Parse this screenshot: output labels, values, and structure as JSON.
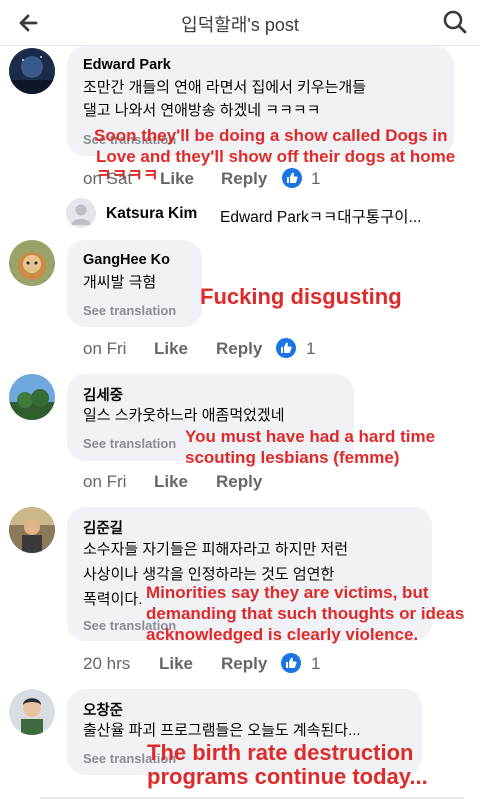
{
  "header": {
    "title": "입덕할래's post"
  },
  "comments": [
    {
      "name": "Edward Park",
      "lines": [
        "조만간 개들의 연애 라면서 집에서 키우는개들",
        "댈고 나와서 연애방송 하겠네 ㅋㅋㅋㅋ"
      ],
      "see_translation": "See translation",
      "time": "on Sat",
      "like": "Like",
      "reply": "Reply",
      "likes": "1",
      "overlay": [
        "Soon they'll be doing a show called Dogs in",
        "Love and they'll show off their dogs at home",
        "ㅋㅋㅋㅋ"
      ]
    },
    {
      "name": "GangHee Ko",
      "lines": [
        "개씨발 극혐"
      ],
      "see_translation": "See translation",
      "time": "on Fri",
      "like": "Like",
      "reply": "Reply",
      "likes": "1",
      "overlay": [
        "Fucking disgusting"
      ]
    },
    {
      "name": "김세중",
      "lines": [
        "일스 스카웃하느라 애좀먹었겠네"
      ],
      "see_translation": "See translation",
      "time": "on Fri",
      "like": "Like",
      "reply": "Reply",
      "overlay": [
        "You must have had a hard time",
        "scouting lesbians (femme)"
      ]
    },
    {
      "name": "김준길",
      "lines": [
        "소수자들 자기들은 피해자라고 하지만 저런",
        "사상이나 생각을 인정하라는 것도 엄연한",
        "폭력이다."
      ],
      "see_translation": "See translation",
      "time": "20 hrs",
      "like": "Like",
      "reply": "Reply",
      "likes": "1",
      "overlay": [
        "Minorities say they are victims, but",
        "demanding that such thoughts or ideas",
        "acknowledged is clearly violence."
      ]
    },
    {
      "name": "오창준",
      "lines": [
        "출산율 파괴 프로그램들은 오늘도 계속된다..."
      ],
      "see_translation": "See translation",
      "overlay": [
        "The birth rate destruction",
        "programs continue today..."
      ]
    }
  ],
  "reply_preview": {
    "name": "Katsura Kim",
    "text": "Edward Parkㅋㅋ대구통구이..."
  },
  "colors": {
    "overlay_red": "#e02a2a",
    "like_blue": "#1b74e4",
    "bubble_bg": "#f0f2f5",
    "muted": "#65676b"
  },
  "icons": {
    "back": "arrow-left-icon",
    "search": "search-icon",
    "like_reaction": "thumbs-up-icon"
  }
}
